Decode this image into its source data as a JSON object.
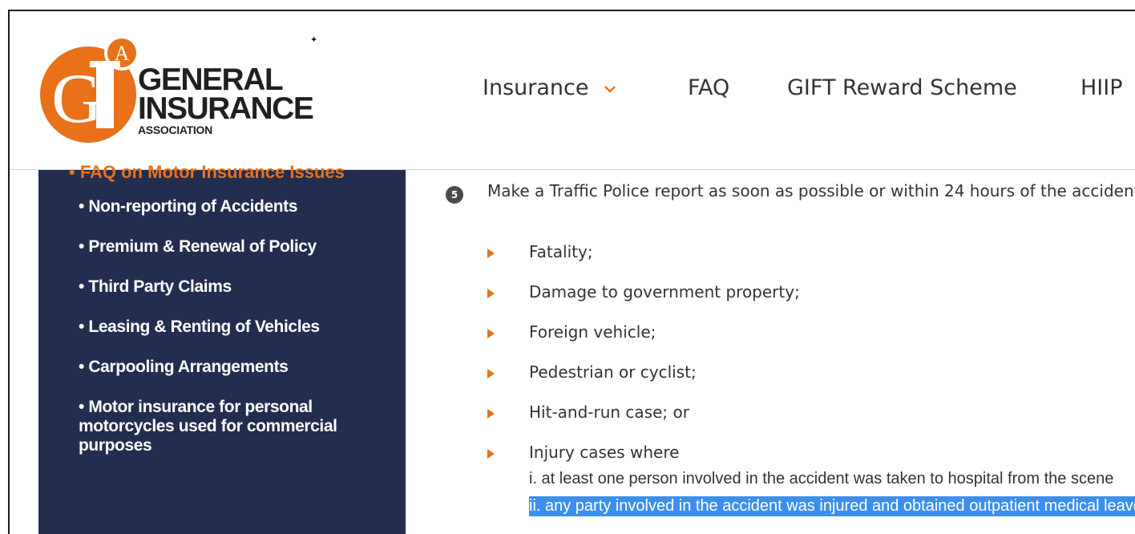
{
  "header": {
    "logo": {
      "emblem_letters": "GIA",
      "line1": "GENERAL",
      "line2": "INSURANCE",
      "line3": "ASSOCIATION"
    },
    "sparkle": "✦",
    "nav": {
      "insurance": "Insurance",
      "faq": "FAQ",
      "gift": "GIFT Reward Scheme",
      "hiip": "HIIP"
    }
  },
  "sidebar": {
    "heading": "• FAQ on Motor Insurance Issues",
    "items": [
      {
        "label": "• Non-reporting of Accidents"
      },
      {
        "label": "• Premium & Renewal of Policy"
      },
      {
        "label": "• Third Party Claims"
      },
      {
        "label": "• Leasing & Renting of Vehicles"
      },
      {
        "label": "• Carpooling Arrangements"
      },
      {
        "label": "• Motor insurance for personal motorcycles used for commercial purposes"
      }
    ]
  },
  "main": {
    "step_number": "5",
    "step_text": "Make a Traffic Police report as soon as possible or within 24 hours of the accident if it involves:",
    "bullets": [
      "Fatality;",
      "Damage to government property;",
      "Foreign vehicle;",
      "Pedestrian or cyclist;",
      "Hit-and-run case; or",
      "Injury cases where"
    ],
    "sub_lines": [
      "i. at least one person involved in the accident was taken to hospital from the scene",
      "ii. any party involved in the accident was injured and obtained outpatient medical leave"
    ]
  },
  "colors": {
    "brand_orange": "#e8711a",
    "sidebar_navy": "#232d4f",
    "selection_blue": "#3c8ff0"
  }
}
